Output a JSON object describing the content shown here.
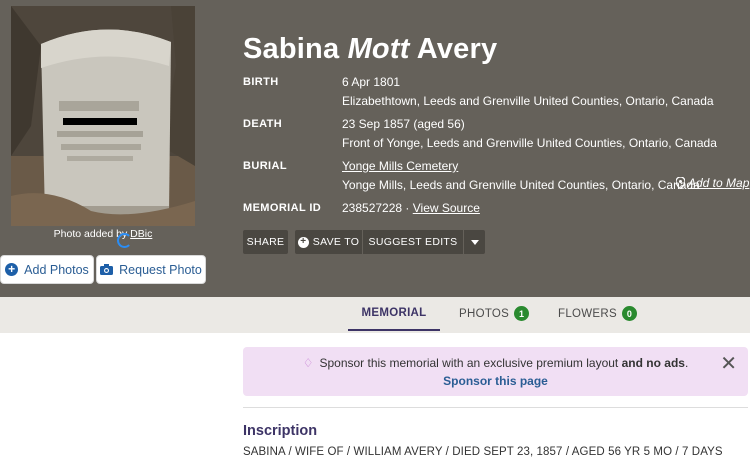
{
  "photo": {
    "credit_prefix": "Photo added by",
    "credit_user": "DBic"
  },
  "buttons": {
    "add_photos": "Add Photos",
    "request_photo": "Request Photo"
  },
  "memorial": {
    "name_first": "Sabina",
    "name_maiden": "Mott",
    "name_last": "Avery",
    "birth_label": "BIRTH",
    "birth_date": "6 Apr 1801",
    "birth_place": "Elizabethtown, Leeds and Grenville United Counties, Ontario, Canada",
    "death_label": "DEATH",
    "death_date": "23 Sep 1857 (aged 56)",
    "death_place": "Front of Yonge, Leeds and Grenville United Counties, Ontario, Canada",
    "burial_label": "BURIAL",
    "burial_cemetery": "Yonge Mills Cemetery",
    "burial_place": "Yonge Mills, Leeds and Grenville United Counties, Ontario, Canada",
    "add_to_map": "Add to Map",
    "id_label": "MEMORIAL ID",
    "id_value": "238527228 ·",
    "view_source": "View Source"
  },
  "actions": {
    "share": "SHARE",
    "save_to": "SAVE TO",
    "suggest_edits": "SUGGEST EDITS"
  },
  "tabs": {
    "memorial": "MEMORIAL",
    "photos": "PHOTOS",
    "photos_count": "1",
    "flowers": "FLOWERS",
    "flowers_count": "0"
  },
  "sponsor": {
    "text_start": "Sponsor this memorial with an exclusive premium layout",
    "text_bold": "and no ads",
    "text_end": ".",
    "link": "Sponsor this page"
  },
  "inscription": {
    "title": "Inscription",
    "text": "SABINA / WIFE OF / WILLIAM AVERY / DIED SEPT 23, 1857 / AGED 56 YR 5 MO / 7 DAYS"
  },
  "colors": {
    "hero_bg": "#65615a",
    "accent_purple": "#3d3466",
    "link_blue": "#2a5d94",
    "badge_green": "#2a8a2f",
    "sponsor_bg": "#f1dff4"
  }
}
